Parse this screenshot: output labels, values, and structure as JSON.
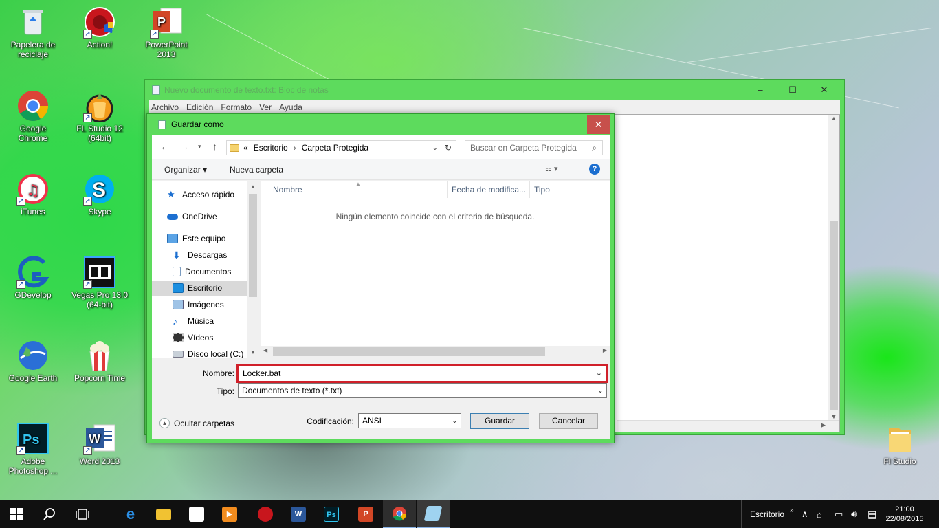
{
  "desktop": {
    "icons": [
      {
        "label_line1": "Papelera de",
        "label_line2": "reciclaje",
        "icon": "recycle-bin-icon"
      },
      {
        "label_line1": "Action!",
        "label_line2": "",
        "icon": "action-icon"
      },
      {
        "label_line1": "PowerPoint 2013",
        "label_line2": "",
        "icon": "powerpoint-icon"
      },
      {
        "label_line1": "Google Chrome",
        "label_line2": "",
        "icon": "chrome-icon"
      },
      {
        "label_line1": "FL Studio 12",
        "label_line2": "(64bit)",
        "icon": "fl-studio-icon"
      },
      {
        "label_line1": "iTunes",
        "label_line2": "",
        "icon": "itunes-icon"
      },
      {
        "label_line1": "Skype",
        "label_line2": "",
        "icon": "skype-icon"
      },
      {
        "label_line1": "GDevelop",
        "label_line2": "",
        "icon": "gdevelop-icon"
      },
      {
        "label_line1": "Vegas Pro 13.0",
        "label_line2": "(64-bit)",
        "icon": "vegas-icon"
      },
      {
        "label_line1": "Google Earth",
        "label_line2": "",
        "icon": "google-earth-icon"
      },
      {
        "label_line1": "Popcorn Time",
        "label_line2": "",
        "icon": "popcorn-icon"
      },
      {
        "label_line1": "Adobe",
        "label_line2": "Photoshop ...",
        "icon": "photoshop-icon"
      },
      {
        "label_line1": "Word 2013",
        "label_line2": "",
        "icon": "word-icon"
      },
      {
        "label_line1": "Fl Studio",
        "label_line2": "",
        "icon": "folder-icon"
      }
    ]
  },
  "notepad": {
    "title": "Nuevo documento de texto.txt: Bloc de notas",
    "controls": {
      "minimize": "–",
      "maximize": "☐",
      "close": "✕"
    },
    "menu": [
      "Archivo",
      "Edición",
      "Formato",
      "Ver",
      "Ayuda"
    ]
  },
  "dialog": {
    "title": "Guardar como",
    "close": "✕",
    "address": {
      "prefix": "«",
      "path": [
        "Escritorio",
        "Carpeta Protegida"
      ]
    },
    "search_placeholder": "Buscar en Carpeta Protegida",
    "toolbar": {
      "organize": "Organizar ▾",
      "new_folder": "Nueva carpeta",
      "help": "?"
    },
    "nav": {
      "quick_access": "Acceso rápido",
      "onedrive": "OneDrive",
      "this_pc": "Este equipo",
      "items": [
        "Descargas",
        "Documentos",
        "Escritorio",
        "Imágenes",
        "Música",
        "Vídeos",
        "Disco local (C:)"
      ],
      "selected": "Escritorio"
    },
    "columns": [
      "Nombre",
      "Fecha de modifica...",
      "Tipo"
    ],
    "empty_message": "Ningún elemento coincide con el criterio de búsqueda.",
    "filename_label": "Nombre:",
    "filename_value": "Locker.bat",
    "type_label": "Tipo:",
    "type_value": "Documentos de texto (*.txt)",
    "hide_folders": "Ocultar carpetas",
    "encoding_label": "Codificación:",
    "encoding_value": "ANSI",
    "save_button": "Guardar",
    "cancel_button": "Cancelar"
  },
  "taskbar": {
    "tray_location": "Escritorio",
    "time": "21:00",
    "date": "22/08/2015"
  },
  "colors": {
    "window_accent": "#5ddb5d",
    "close_red": "#c7504b",
    "highlight_red": "#d0202a"
  }
}
